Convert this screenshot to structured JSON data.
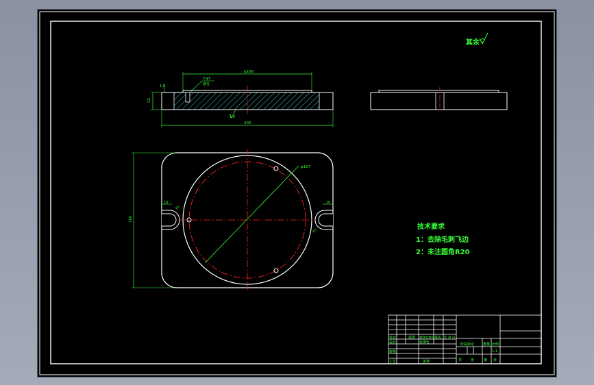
{
  "title_block_mark": "其余",
  "roughness_symbol": "check-like-roughness-icon",
  "section_view": {
    "top_dim": "φ168",
    "left_dim_v": "22",
    "left_dim_small": "1.6",
    "detail_label_1": "2-φ5",
    "detail_label_2": "通孔",
    "bottom_dim": "200",
    "roughness_value": "1.6"
  },
  "plan_view": {
    "diameter_label": "φ157",
    "height_dim": "160",
    "slot_left_dim": "10",
    "slot_left_r": "R5",
    "slot_right_dim": "10",
    "slot_right_r": "R5"
  },
  "tech_requirements": {
    "heading": "技术要求",
    "item1": "1：去除毛刺飞边",
    "item2": "2：未注圆角R20"
  },
  "title_block": {
    "label_1": "标记",
    "label_2": "处数",
    "label_3": "更改文件号",
    "label_4": "签名",
    "label_5": "年 月 日",
    "label_6": "设计",
    "label_7": "标准化",
    "label_8": "阶段标记",
    "label_9": "重量",
    "label_10": "比例",
    "label_11": "审核",
    "label_12": "工艺",
    "label_13": "批准",
    "label_14": "共",
    "label_15": "张",
    "label_16": "第",
    "label_17": "张",
    "scale_value": "1:1"
  },
  "colors": {
    "background": "#000000",
    "line_white": "#ffffff",
    "dimension_green": "#39ff39",
    "centerline_red": "#ff2020"
  }
}
